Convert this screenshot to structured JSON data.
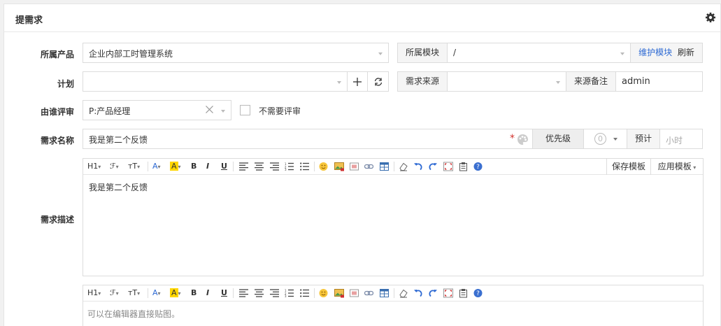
{
  "panel": {
    "title": "提需求",
    "settings_icon": "gear-icon"
  },
  "product": {
    "label": "所属产品",
    "value": "企业内部工时管理系统"
  },
  "module": {
    "label": "所属模块",
    "value": "/",
    "maintain_link": "维护模块",
    "refresh_link": "刷新"
  },
  "plan": {
    "label": "计划",
    "value": "",
    "add_icon": "plus-icon",
    "refresh_icon": "refresh-icon"
  },
  "source": {
    "label": "需求来源",
    "value": "",
    "note_label": "来源备注",
    "note_value": "admin"
  },
  "reviewer": {
    "label": "由谁评审",
    "value": "P:产品经理",
    "no_review_label": "不需要评审"
  },
  "name": {
    "label": "需求名称",
    "value": "我是第二个反馈",
    "required_mark": "*",
    "priority_label": "优先级",
    "priority_value": "0",
    "estimate_label": "预计",
    "estimate_placeholder": "小时"
  },
  "description": {
    "label": "需求描述",
    "content": "我是第二个反馈",
    "save_template": "保存模板",
    "apply_template": "应用模板"
  },
  "toolbar": {
    "heading": "H1",
    "font_family": "ℱ",
    "font_size": "тT",
    "font_color": "A",
    "bg_color": "A",
    "bold": "B",
    "italic": "I",
    "underline": "U"
  },
  "second_editor": {
    "placeholder": "可以在编辑器直接贴图。"
  },
  "colors": {
    "link": "#2e6ad3",
    "required": "#d2322d",
    "highlight": "#ffd600",
    "border": "#dcdcdc"
  }
}
